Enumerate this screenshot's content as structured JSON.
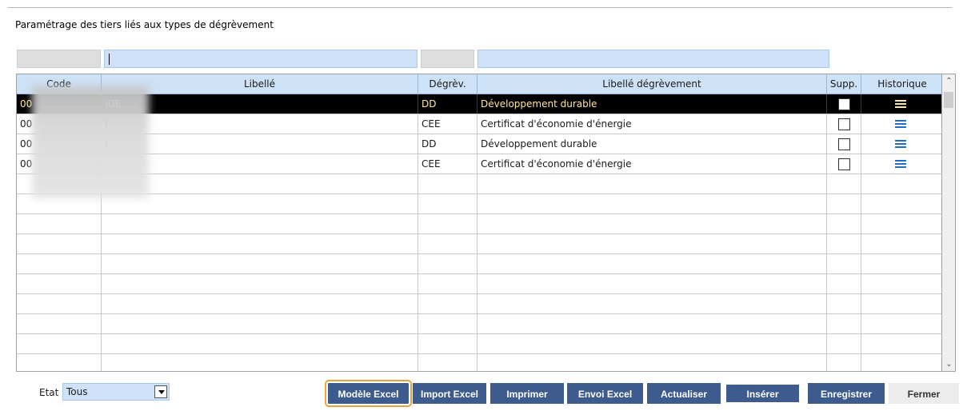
{
  "title": "Paramétrage des tiers liés aux types de dégrèvement",
  "grid": {
    "columns": [
      "Code",
      "Libellé",
      "Dégrèv.",
      "Libellé dégrèvement",
      "Supp.",
      "Historique"
    ],
    "rows": [
      {
        "code": "00",
        "libelle": "IDE",
        "degrev": "DD",
        "libelle_degrev": "Développement durable",
        "selected": true
      },
      {
        "code": "00",
        "libelle": "I",
        "degrev": "CEE",
        "libelle_degrev": "Certificat d'économie d'énergie"
      },
      {
        "code": "00",
        "libelle": "I",
        "degrev": "DD",
        "libelle_degrev": "Développement durable"
      },
      {
        "code": "00",
        "libelle": "",
        "degrev": "CEE",
        "libelle_degrev": "Certificat d'économie d'énergie"
      }
    ],
    "history_icon": "list-icon"
  },
  "footer": {
    "etat_label": "Etat",
    "etat_value": "Tous",
    "buttons": {
      "modele_excel": "Modèle Excel",
      "import_excel": "Import Excel",
      "imprimer": "Imprimer",
      "envoi_excel": "Envoi Excel",
      "actualiser": "Actualiser",
      "inserer": "Insérer",
      "enregistrer": "Enregistrer",
      "fermer": "Fermer"
    }
  },
  "colors": {
    "button": "#3d5b8c",
    "header": "#cde1f7",
    "filter": "#cfe2fa",
    "focus": "#e8a33a",
    "selected_text": "#ffe7a3"
  }
}
